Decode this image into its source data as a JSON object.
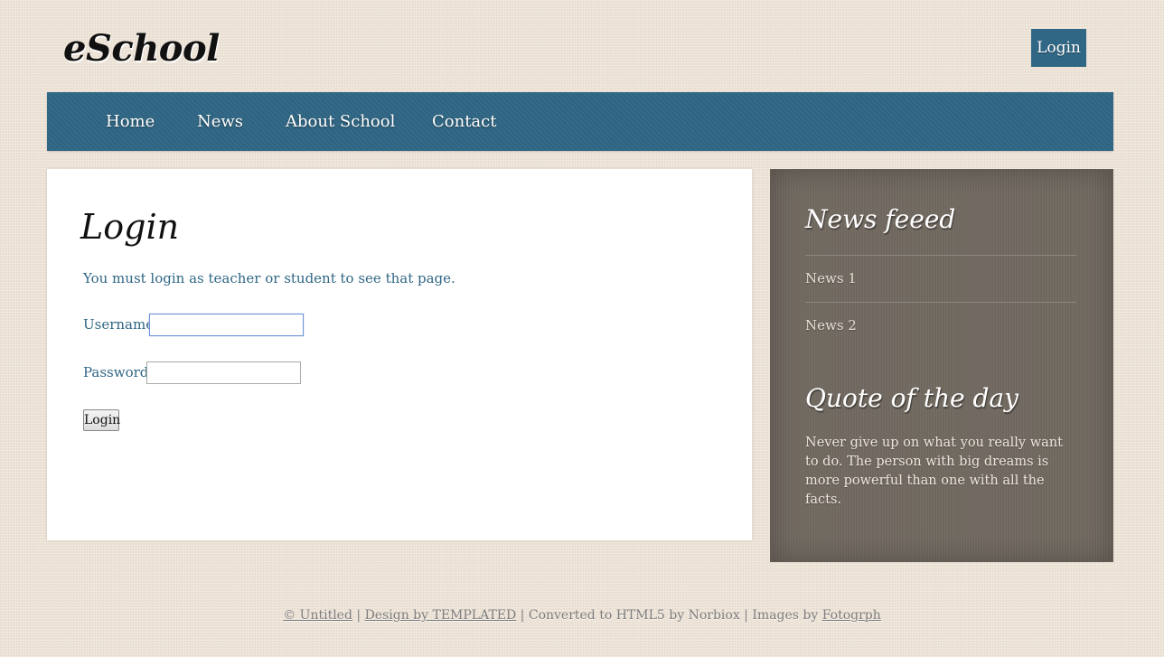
{
  "header": {
    "logo": "eSchool",
    "login_button": "Login"
  },
  "nav": {
    "items": [
      {
        "label": "Home"
      },
      {
        "label": "News"
      },
      {
        "label": "About School"
      },
      {
        "label": "Contact"
      }
    ]
  },
  "main": {
    "title": "Login",
    "notice": "You must login as teacher or student to see that page.",
    "form": {
      "username_label": "Username:",
      "username_value": "",
      "password_label": "Password:",
      "password_value": "",
      "submit_label": "Login"
    }
  },
  "sidebar": {
    "news_heading": "News feeed",
    "news_items": [
      {
        "label": "News 1"
      },
      {
        "label": "News 2"
      }
    ],
    "quote_heading": "Quote of the day",
    "quote_text": "Never give up on what you really want to do. The person with big dreams is more powerful than one with all the facts."
  },
  "footer": {
    "copyright": "© Untitled",
    "sep1": " | ",
    "design_link": "Design by TEMPLATED",
    "converted": " | Converted to HTML5 by Norbiox | Images by ",
    "images_link": "Fotogrph"
  },
  "colors": {
    "accent_blue": "#306785",
    "background": "#efe3d6",
    "sidebar": "#736b62"
  }
}
